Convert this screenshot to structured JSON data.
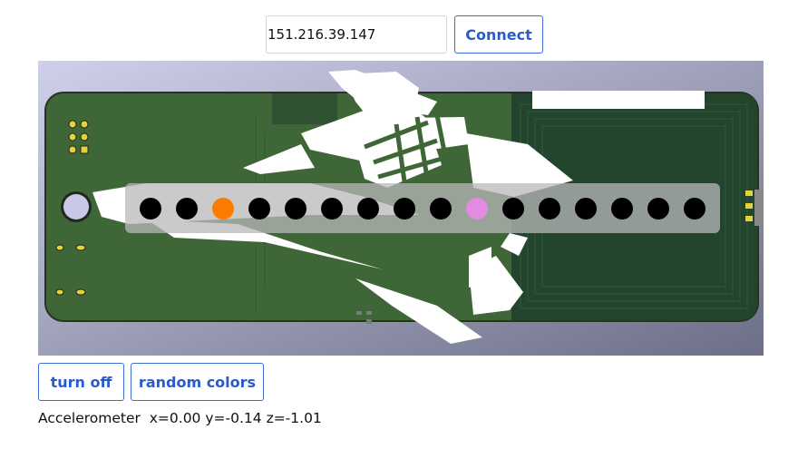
{
  "connection": {
    "ip_value": "151.216.39.147",
    "connect_label": "Connect"
  },
  "controls": {
    "turn_off_label": "turn off",
    "random_colors_label": "random colors"
  },
  "accelerometer": {
    "label": "Accelerometer",
    "x_text": "x=0.00",
    "y_text": "y=-0.14",
    "z_text": "z=-1.01"
  },
  "board": {
    "background_gradient": [
      "#cfd0ea",
      "#6d6f88"
    ],
    "pcb_color": "#3f6636",
    "pcb_dark_color": "#23452e",
    "led_strip_color": "#b8b8b8",
    "leds": [
      "#000000",
      "#000000",
      "#ff7b00",
      "#000000",
      "#000000",
      "#000000",
      "#000000",
      "#000000",
      "#000000",
      "#e28be2",
      "#000000",
      "#000000",
      "#000000",
      "#000000",
      "#000000",
      "#000000"
    ]
  }
}
